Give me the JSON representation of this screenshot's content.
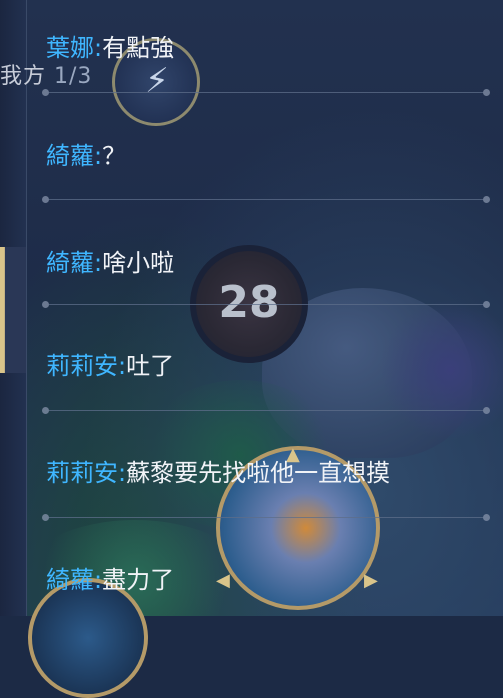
{
  "hud": {
    "team_label": "我方",
    "team_count": "1/3",
    "timer": "28",
    "hero_icon": "lightning-hero-icon",
    "skill_icon": "hero-skill-icon"
  },
  "chat": {
    "messages": [
      {
        "name": "葉娜",
        "sep": ":",
        "text": "有點強"
      },
      {
        "name": "綺蘿",
        "sep": ":",
        "text": "？"
      },
      {
        "name": "綺蘿",
        "sep": ":",
        "text": "啥小啦"
      },
      {
        "name": "莉莉安",
        "sep": ":",
        "text": "吐了"
      },
      {
        "name": "莉莉安",
        "sep": ":",
        "text": "蘇黎要先找啦他一直想摸"
      },
      {
        "name": "綺蘿",
        "sep": ":",
        "text": "盡力了"
      }
    ]
  },
  "colors": {
    "name": "#3fb6ff",
    "text": "#f1f3f7",
    "accent_gold": "#b49a68"
  }
}
